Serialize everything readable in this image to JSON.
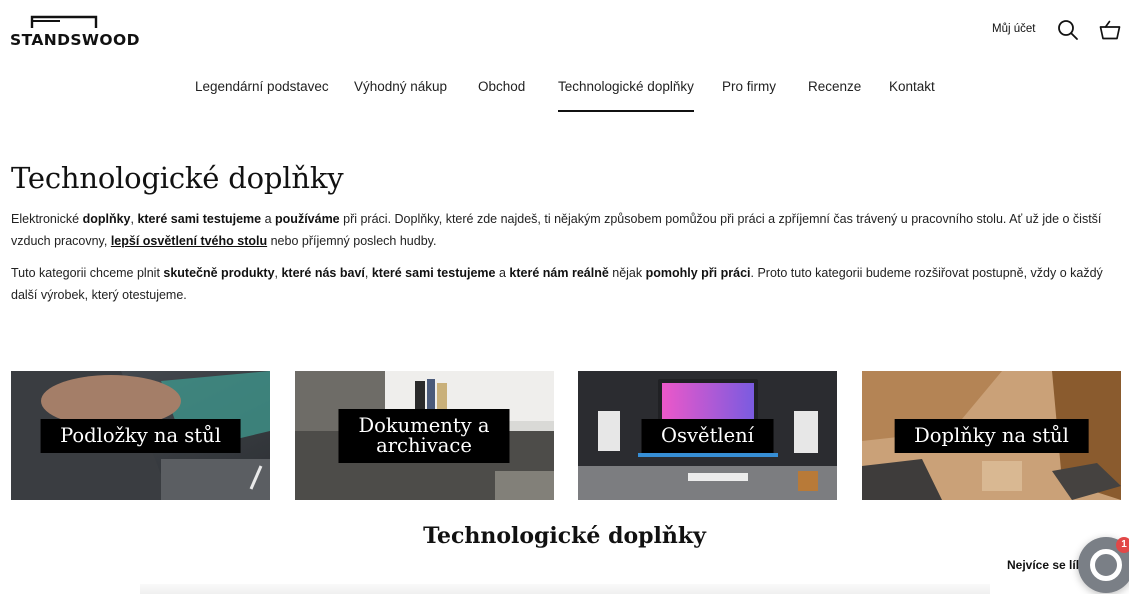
{
  "header": {
    "logo_text": "STANDSWOOD",
    "account_label": "Můj účet"
  },
  "nav": {
    "items": [
      {
        "label": "Legendární podstavec"
      },
      {
        "label": "Výhodný nákup"
      },
      {
        "label": "Obchod"
      },
      {
        "label": "Technologické doplňky",
        "active": true
      },
      {
        "label": "Pro firmy"
      },
      {
        "label": "Recenze"
      },
      {
        "label": "Kontakt"
      }
    ]
  },
  "page": {
    "title": "Technologické doplňky",
    "intro1": {
      "t1": "Elektronické ",
      "b1": "doplňky",
      "t2": ", ",
      "b2": "které sami testujeme",
      "t3": " a ",
      "b3": "používáme",
      "t4": " při práci. Doplňky, které zde najdeš, ti  nějakým způsobem pomůžou při práci a zpříjemní čas trávený u pracovního stolu. Ať už jde o čistší vzduch pracovny, ",
      "link": "lepší osvětlení tvého stolu",
      "t5": " nebo příjemný poslech hudby."
    },
    "intro2": {
      "t1": "Tuto kategorii chceme plnit ",
      "b1": "skutečně produkty",
      "t2": ", ",
      "b2": "které nás baví",
      "t3": ", ",
      "b3": "které sami testujeme",
      "t4": " a ",
      "b4": "které nám reálně",
      "t5": " nějak ",
      "b5": "pomohly při práci",
      "t6": ". Proto tuto kategorii budeme rozšiřovat postupně, vždy o každý další výrobek, který otestujeme."
    }
  },
  "categories": [
    {
      "label": "Podložky na stůl"
    },
    {
      "label_line1": "Dokumenty a",
      "label_line2": "archivace"
    },
    {
      "label": "Osvětlení"
    },
    {
      "label": "Doplňky na stůl"
    }
  ],
  "products": {
    "section_title": "Technologické doplňky",
    "sort_label": "Nejvíce se líbí"
  },
  "chat": {
    "badge_count": "1"
  },
  "icons": {
    "search": "search-icon",
    "cart": "basket-icon",
    "chat": "chat-icon"
  },
  "colors": {
    "text": "#111111",
    "label_bg": "#000000",
    "badge": "#e24848"
  }
}
